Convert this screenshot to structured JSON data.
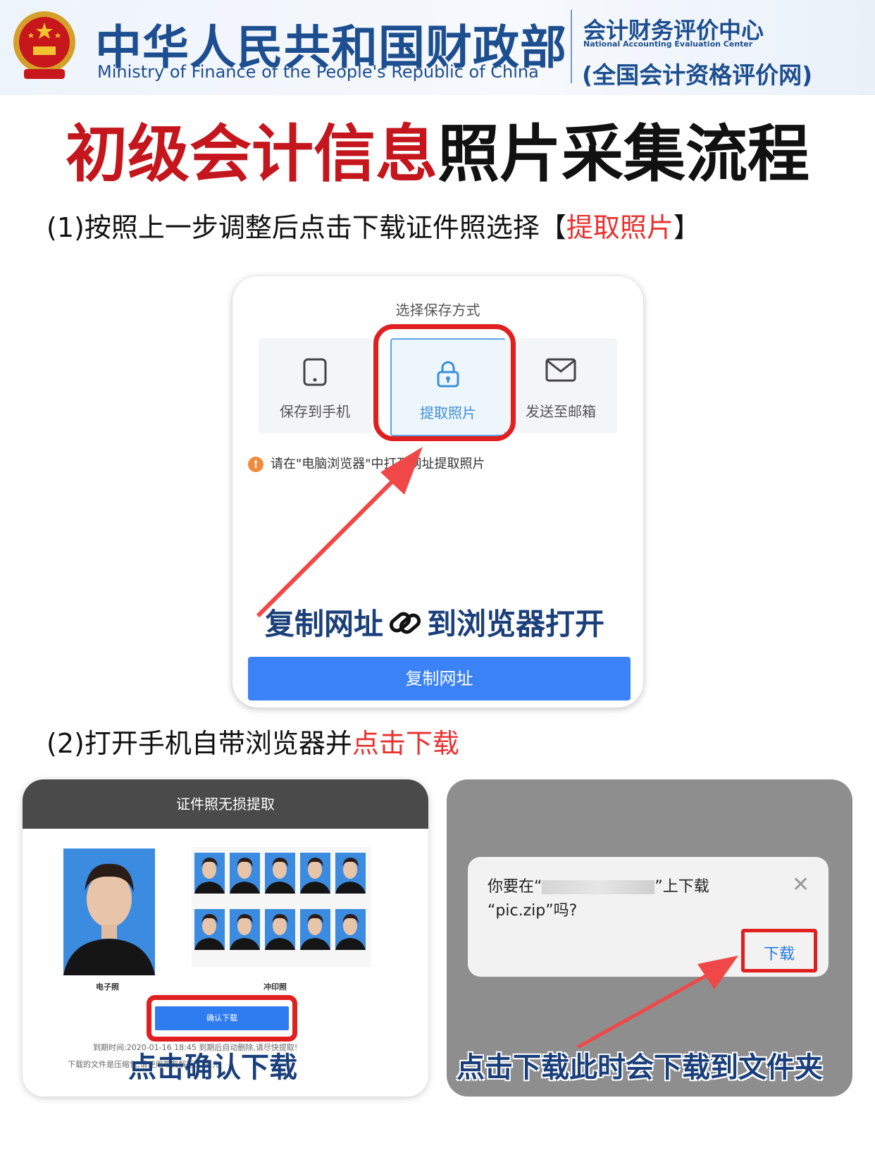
{
  "header": {
    "ministry_cn": "中华人民共和国财政部",
    "ministry_en": "Ministry of Finance of the People's Republic of China",
    "center_cn": "会计财务评价中心",
    "center_en": "National Accounting Evaluation Center",
    "center_sub": "(全国会计资格评价网)"
  },
  "title": {
    "red_part": "初级会计信息",
    "black_part": "照片采集流程"
  },
  "step1": {
    "prefix": "(1)按照上一步调整后点击下载证件照选择【",
    "highlight": "提取照片",
    "suffix": "】"
  },
  "save_dialog": {
    "title": "选择保存方式",
    "options": [
      {
        "label": "保存到手机",
        "icon": "phone-icon"
      },
      {
        "label": "提取照片",
        "icon": "lock-icon"
      },
      {
        "label": "发送至邮箱",
        "icon": "mail-icon"
      }
    ],
    "hint": "请在\"电脑浏览器\"中打开网址提取照片",
    "caption_left": "复制网址",
    "caption_right": "到浏览器打开",
    "copy_button": "复制网址"
  },
  "step2": {
    "prefix": "(2)打开手机自带浏览器并",
    "highlight": "点击下载"
  },
  "extract_page": {
    "bar_title": "证件照无损提取",
    "photo_label": "电子照",
    "sheet_label": "冲印照",
    "confirm_button": "确认下载",
    "expire_text": "到期时间:2020-01-16 18:45 到期后自动删除,请尽快提取!",
    "note_text": "下载的文件是压缩包,请使用带有解压工具,先",
    "caption": "点击确认下载"
  },
  "download_dialog": {
    "line1_prefix": "你要在“",
    "line1_suffix": "”上下载",
    "line2": "“pic.zip”吗?",
    "download_button": "下载",
    "close": "✕",
    "caption": "点击下载此时会下载到文件夹"
  },
  "colors": {
    "brand_blue": "#1d4e8f",
    "title_red": "#c4161c",
    "highlight_red": "#e8322f",
    "button_blue": "#3b82f6",
    "box_red": "#e02020"
  }
}
